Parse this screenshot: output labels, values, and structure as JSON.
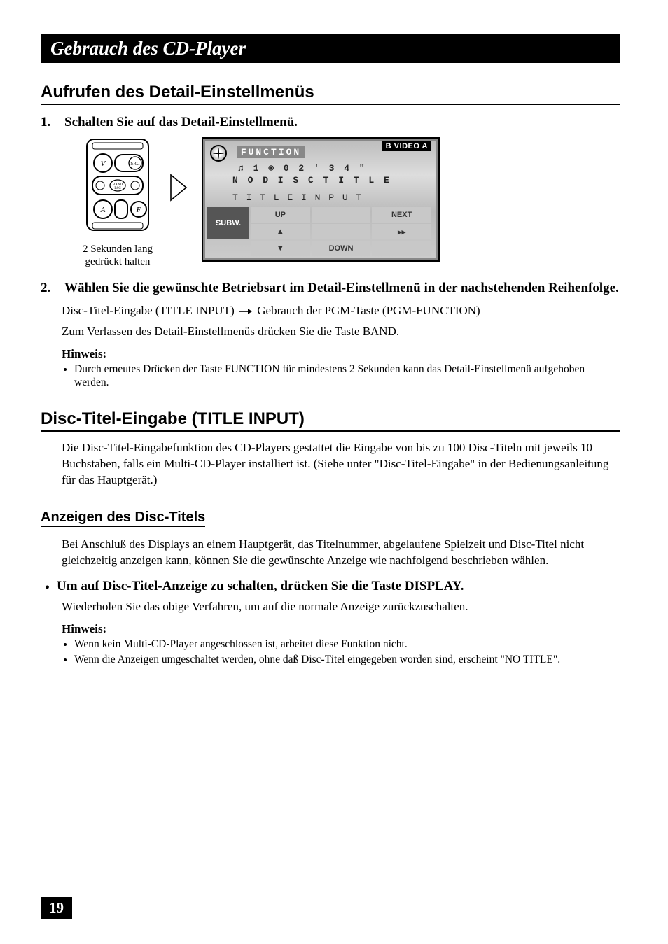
{
  "chapter_title": "Gebrauch des CD-Player",
  "section1": {
    "heading": "Aufrufen des Detail-Einstellmenüs",
    "step1": {
      "num": "1.",
      "text": "Schalten Sie auf das Detail-Einstellmenü."
    },
    "remote_caption_line1": "2 Sekunden lang",
    "remote_caption_line2": "gedrückt halten",
    "screen": {
      "badge": "B VIDEO A",
      "func_label": "FUNCTION",
      "track_line": "♫  1    ⊙ 0 2 ' 3 4 \"",
      "no_disc_title": "N O   D I S C   T I T L E",
      "title_input": "T I T L E   I N P U T",
      "softkeys": {
        "subw": "SUBW.",
        "up": "UP",
        "down": "DOWN",
        "next": "NEXT",
        "up_arrow": "▲",
        "down_arrow": "▼",
        "next_arrow": "▸▸"
      }
    },
    "step2": {
      "num": "2.",
      "text": "Wählen Sie die gewünschte Betriebsart im Detail-Einstellmenü in der nachstehenden Reihenfolge."
    },
    "body_line1_a": "Disc-Titel-Eingabe (TITLE INPUT) ",
    "body_line1_b": " Gebrauch der PGM-Taste (PGM-FUNCTION)",
    "body_line2": "Zum Verlassen des Detail-Einstellmenüs drücken Sie die Taste BAND.",
    "hinweis_label": "Hinweis:",
    "hinweis_item": "Durch erneutes Drücken der Taste FUNCTION für mindestens 2 Sekunden kann das Detail-Einstellmenü aufgehoben werden."
  },
  "section2": {
    "heading": "Disc-Titel-Eingabe (TITLE INPUT)",
    "body": "Die Disc-Titel-Eingabefunktion des CD-Players gestattet die Eingabe von bis zu 100 Disc-Titeln mit jeweils 10 Buchstaben, falls ein Multi-CD-Player installiert ist. (Siehe unter \"Disc-Titel-Eingabe\" in der Bedienungsanleitung für das Hauptgerät.)"
  },
  "section3": {
    "heading": "Anzeigen des Disc-Titels",
    "body": "Bei Anschluß des Displays an einem Hauptgerät, das Titelnummer, abgelaufene Spielzeit und Disc-Titel nicht gleichzeitig anzeigen kann, können Sie die gewünschte Anzeige wie nachfolgend beschrieben wählen.",
    "bullet": "Um auf Disc-Titel-Anzeige zu schalten, drücken Sie die Taste DISPLAY.",
    "sub_body": "Wiederholen Sie das obige Verfahren, um auf die normale Anzeige zurückzuschalten.",
    "hinweis_label": "Hinweis:",
    "hinweis_items": [
      "Wenn kein Multi-CD-Player angeschlossen ist, arbeitet diese Funktion nicht.",
      "Wenn die Anzeigen umgeschaltet werden, ohne daß Disc-Titel eingegeben worden sind, erscheint \"NO TITLE\"."
    ]
  },
  "page_number": "19",
  "remote_labels": {
    "v": "V",
    "src": "SRC",
    "band": "BAND\nESC",
    "a": "A",
    "f": "F"
  }
}
